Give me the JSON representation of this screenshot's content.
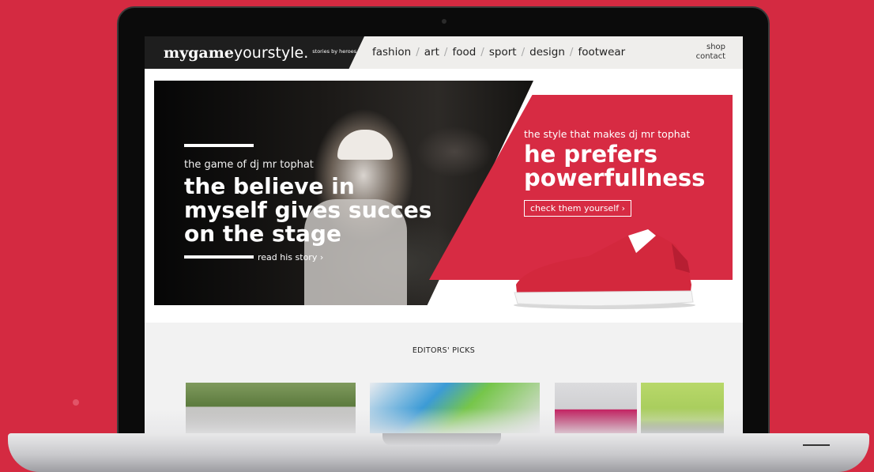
{
  "site": {
    "logo_bold": "mygame",
    "logo_light": "yourstyle.",
    "logo_tagline": "stories by heroes"
  },
  "nav": {
    "items": [
      "fashion",
      "art",
      "food",
      "sport",
      "design",
      "footwear"
    ],
    "separator": "/"
  },
  "util_links": {
    "shop": "shop",
    "contact": "contact"
  },
  "hero": {
    "kicker": "the game of dj mr tophat",
    "title": "the believe in myself gives succes on the stage",
    "link": "read his story ›"
  },
  "promo": {
    "kicker": "the style that makes dj mr tophat",
    "title_line1": "he prefers",
    "title_line2": "powerfullness",
    "cta": "check them yourself ›"
  },
  "editors_picks": {
    "title": "EDITORS' PICKS",
    "thumbnails": [
      "skateboarder",
      "colorful-toys-sneaker",
      "man-in-cap",
      "green-sneaker"
    ]
  },
  "colors": {
    "brand_red": "#d72b43",
    "background_red": "#d42a41",
    "header_dark": "#1e1e1e"
  }
}
